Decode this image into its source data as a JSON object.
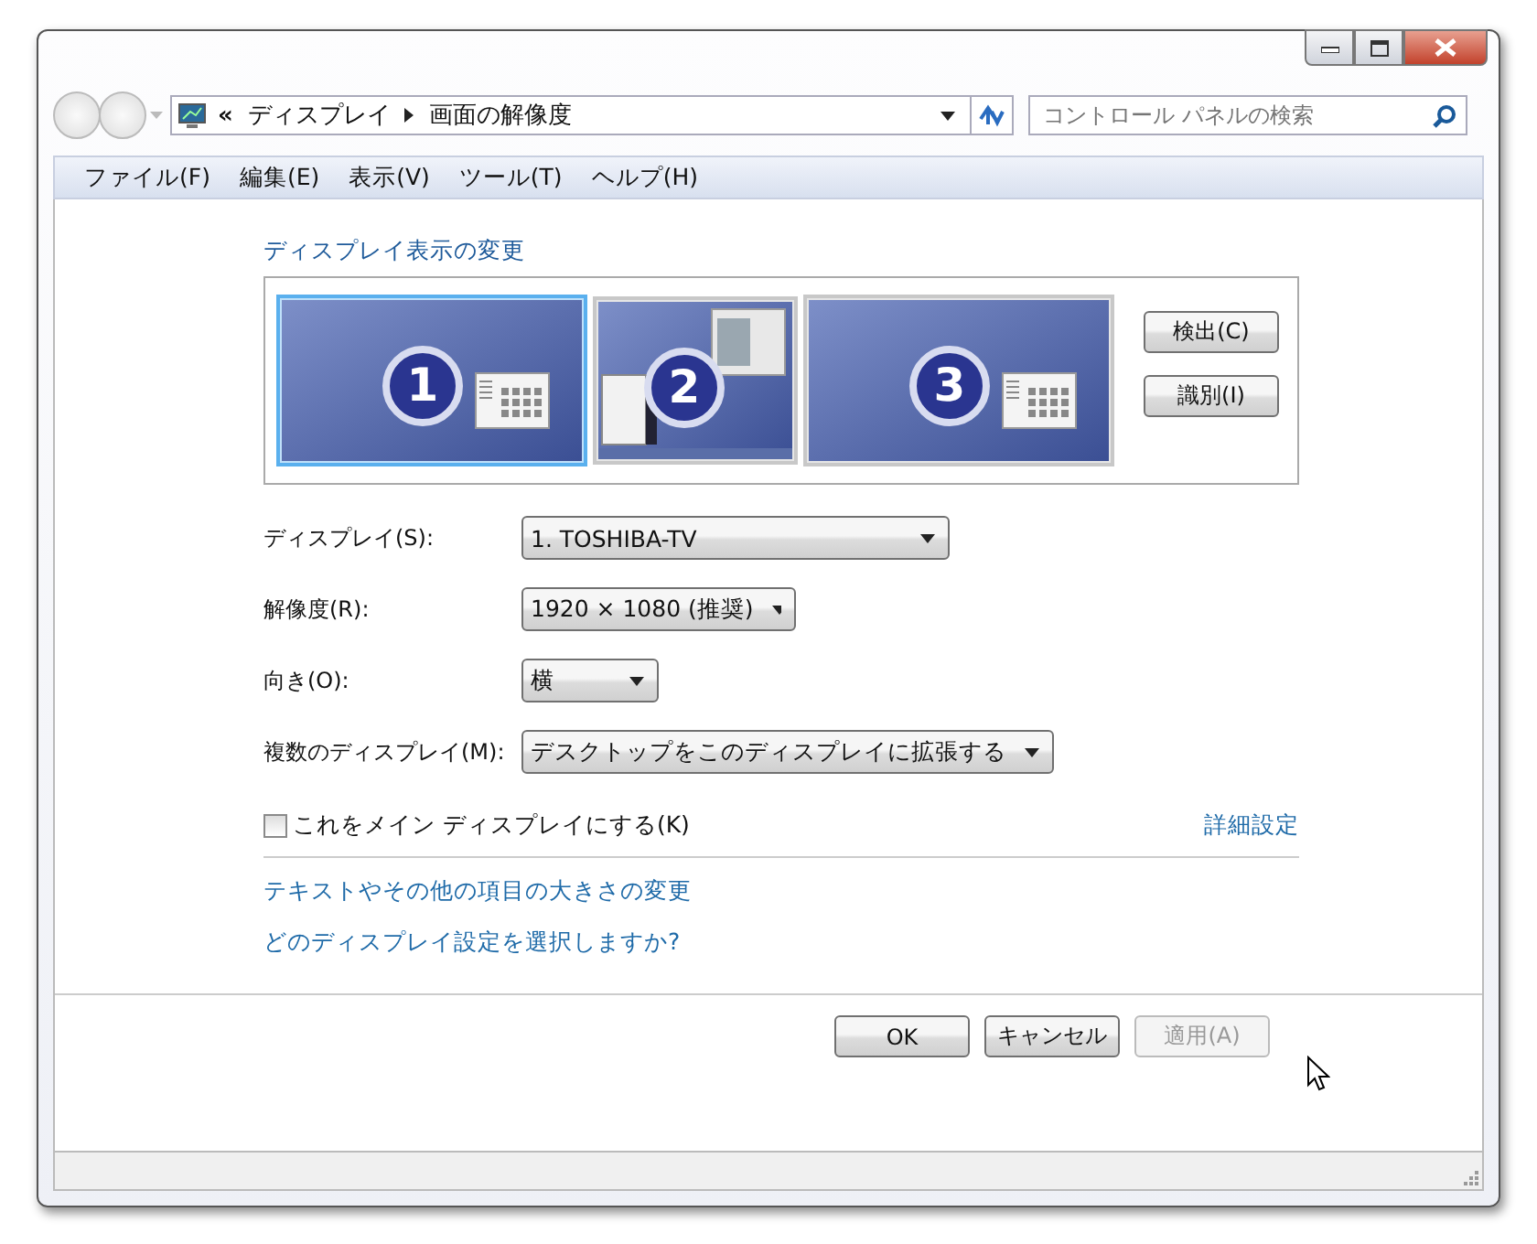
{
  "address": {
    "overflow": "«",
    "crumbs": [
      "ディスプレイ",
      "画面の解像度"
    ]
  },
  "search": {
    "placeholder": "コントロール パネルの検索"
  },
  "menu": [
    "ファイル(F)",
    "編集(E)",
    "表示(V)",
    "ツール(T)",
    "ヘルプ(H)"
  ],
  "heading": "ディスプレイ表示の変更",
  "monitors": [
    {
      "number": "1",
      "kind": "wide",
      "selected": true
    },
    {
      "number": "2",
      "kind": "narrow",
      "selected": false
    },
    {
      "number": "3",
      "kind": "wide",
      "selected": false
    }
  ],
  "side_buttons": [
    "検出(C)",
    "識別(I)"
  ],
  "fields": [
    {
      "label": "ディスプレイ(S):",
      "value": "1. TOSHIBA-TV",
      "kind": "long"
    },
    {
      "label": "解像度(R):",
      "value": "1920 × 1080 (推奨)",
      "kind": "medium"
    },
    {
      "label": "向き(O):",
      "value": "横",
      "kind": "short"
    },
    {
      "label": "複数のディスプレイ(M):",
      "value": "デスクトップをこのディスプレイに拡張する",
      "kind": "auto"
    }
  ],
  "main_display": {
    "label": "これをメイン ディスプレイにする(K)",
    "checked": false
  },
  "advanced_link": "詳細設定",
  "links": [
    "テキストやその他の項目の大きさの変更",
    "どのディスプレイ設定を選択しますか?"
  ],
  "buttons": [
    {
      "label": "OK",
      "disabled": false
    },
    {
      "label": "キャンセル",
      "disabled": false
    },
    {
      "label": "適用(A)",
      "disabled": true
    }
  ]
}
